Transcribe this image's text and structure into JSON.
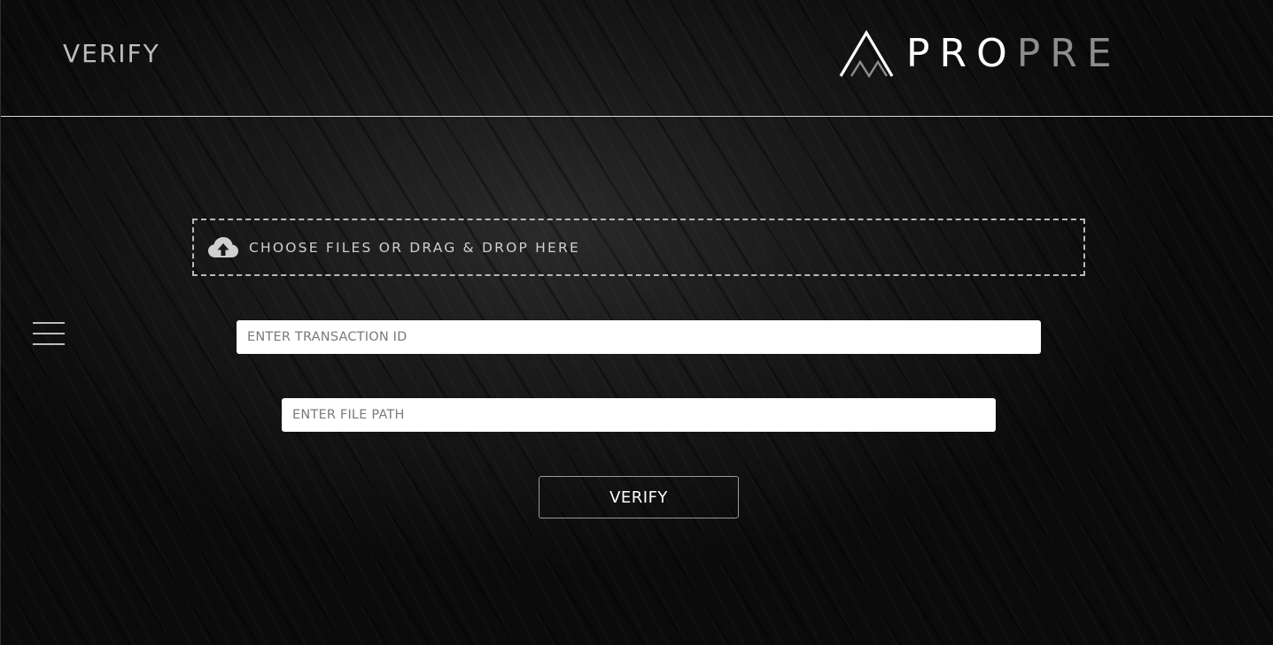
{
  "header": {
    "title": "VERIFY",
    "brand": {
      "name_primary": "PRO",
      "name_secondary": "PRE",
      "icon": "propre-logo-mark"
    }
  },
  "sidebar": {
    "menu_icon": "hamburger-menu-icon"
  },
  "upload": {
    "icon": "cloud-upload-icon",
    "label": "CHOOSE FILES OR DRAG & DROP HERE"
  },
  "form": {
    "transaction_id": {
      "placeholder": "ENTER TRANSACTION ID",
      "value": ""
    },
    "file_path": {
      "placeholder": "ENTER FILE PATH",
      "value": ""
    },
    "submit_label": "VERIFY"
  },
  "colors": {
    "background": "#111111",
    "header_divider": "#d9d9d9",
    "title_text": "#bdbdbd",
    "brand_primary": "#ffffff",
    "brand_secondary": "#8d8d8d",
    "field_background": "#ffffff",
    "button_border": "#9a9a9a"
  }
}
